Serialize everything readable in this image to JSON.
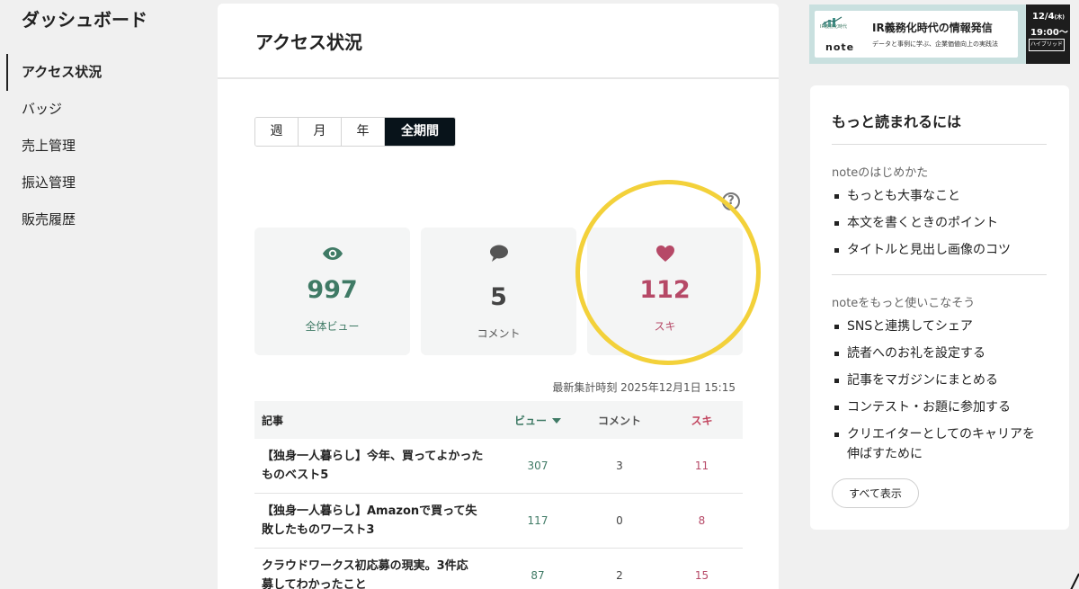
{
  "sidebar": {
    "title": "ダッシュボード",
    "items": [
      {
        "label": "アクセス状況",
        "active": true
      },
      {
        "label": "バッジ"
      },
      {
        "label": "売上管理"
      },
      {
        "label": "振込管理"
      },
      {
        "label": "販売履歴"
      }
    ]
  },
  "main": {
    "title": "アクセス状況",
    "periods": [
      "週",
      "月",
      "年",
      "全期間"
    ],
    "selected_period": "全期間",
    "help_icon": "question-circle-icon",
    "stats": {
      "views": {
        "icon": "eye-icon",
        "value": "997",
        "label": "全体ビュー",
        "color": "#3f7a65"
      },
      "comments": {
        "icon": "speech-bubble-icon",
        "value": "5",
        "label": "コメント",
        "color": "#444444"
      },
      "likes": {
        "icon": "heart-icon",
        "value": "112",
        "label": "スキ",
        "color": "#b64967"
      }
    },
    "highlight_color": "#f3d13a",
    "updated_at": "最新集計時刻 2025年12月1日 15:15",
    "table": {
      "headers": {
        "title": "記事",
        "views": "ビュー",
        "comments": "コメント",
        "likes": "スキ"
      },
      "sort": "views-desc",
      "rows": [
        {
          "title_line1": "【独身一人暮らし】今年、買ってよかった",
          "title_line2": "ものベスト5",
          "views": "307",
          "comments": "3",
          "likes": "11"
        },
        {
          "title_line1": "【独身一人暮らし】Amazonで買って失",
          "title_line2": "敗したものワースト3",
          "views": "117",
          "comments": "0",
          "likes": "8"
        },
        {
          "title_line1": "クラウドワークス初応募の現実。3件応",
          "title_line2": "募してわかったこと",
          "views": "87",
          "comments": "2",
          "likes": "15"
        }
      ]
    }
  },
  "banner": {
    "logo_small": "IR義務化時代",
    "logo": "note",
    "title": "IR義務化時代の情報発信",
    "subtitle": "データと事例に学ぶ、企業価値向上の実践法",
    "date": "12/4",
    "weekday": "(木)",
    "time": "19:00〜",
    "tag": "ハイブリッド",
    "bg_color": "#c9e0df"
  },
  "tips": {
    "title": "もっと読まれるには",
    "section1": {
      "title": "noteのはじめかた",
      "items": [
        "もっとも大事なこと",
        "本文を書くときのポイント",
        "タイトルと見出し画像のコツ"
      ]
    },
    "section2": {
      "title": "noteをもっと使いこなそう",
      "items": [
        "SNSと連携してシェア",
        "読者へのお礼を設定する",
        "記事をマガジンにまとめる",
        "コンテスト・お題に参加する",
        "クリエイターとしてのキャリアを伸ばすために"
      ]
    },
    "show_all": "すべて表示"
  }
}
